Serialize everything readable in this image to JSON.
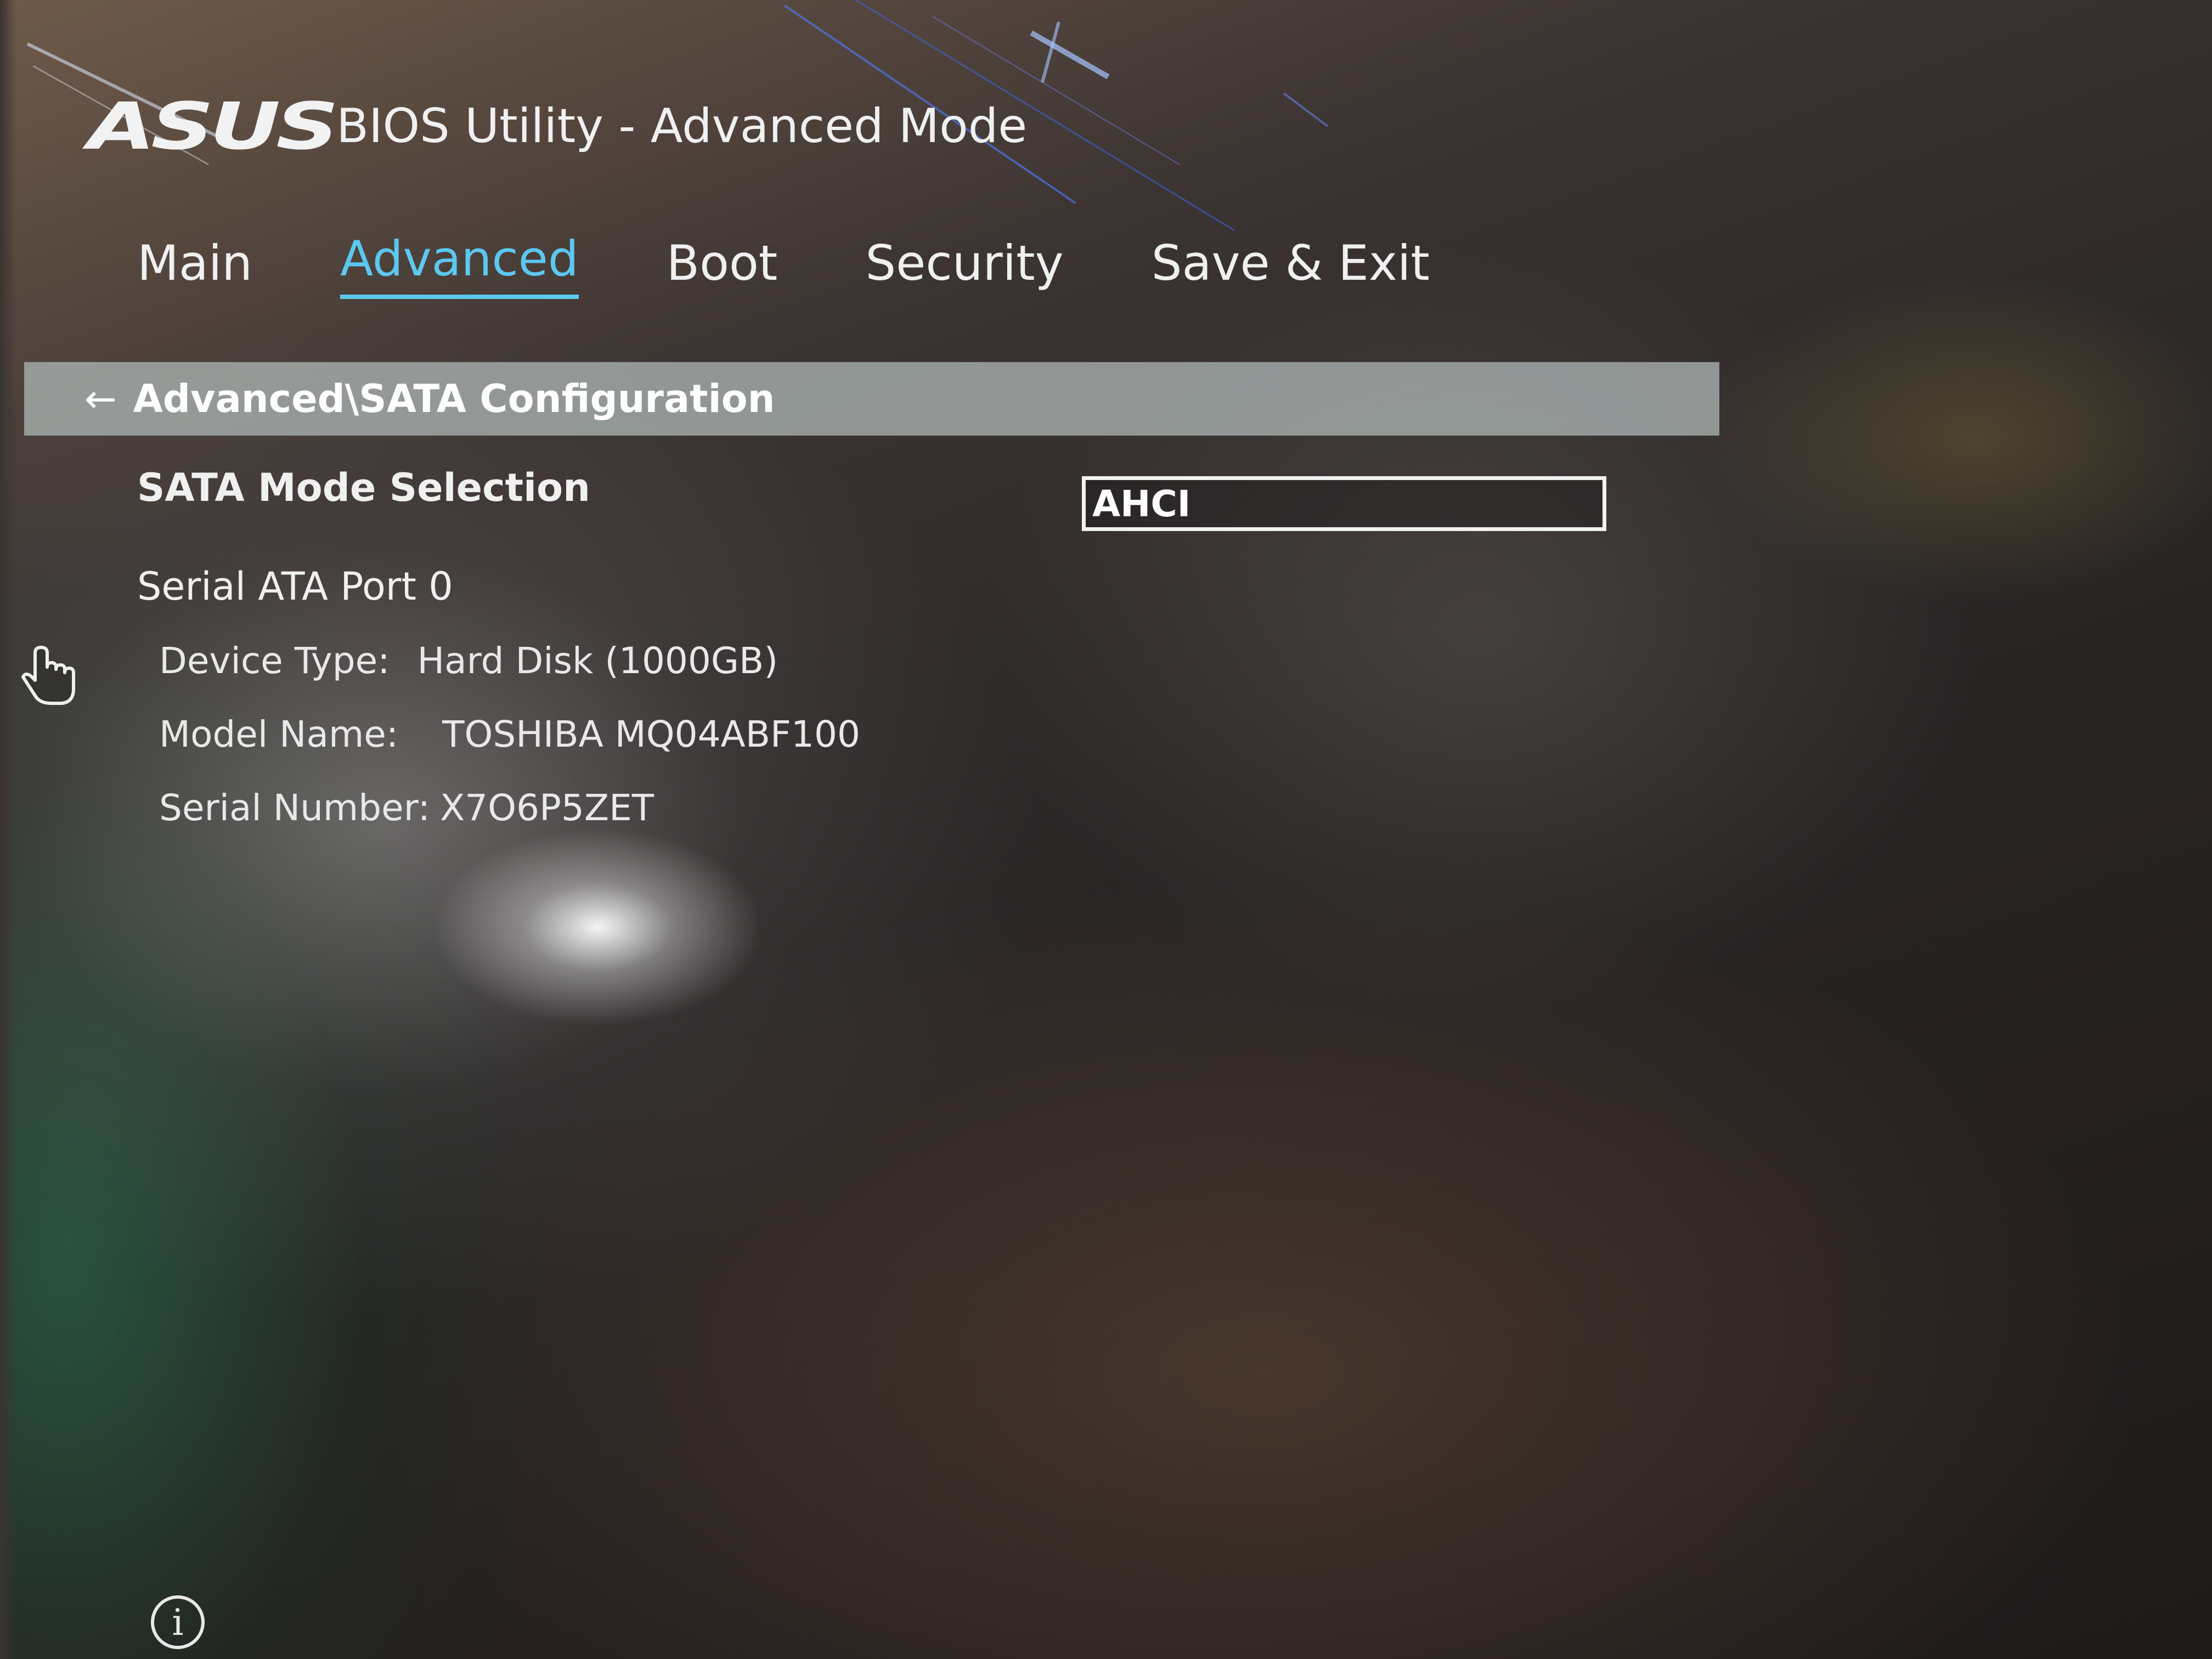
{
  "header": {
    "logo": "ASUS",
    "title": "BIOS Utility - Advanced Mode"
  },
  "tabs": [
    {
      "label": "Main",
      "active": false
    },
    {
      "label": "Advanced",
      "active": true
    },
    {
      "label": "Boot",
      "active": false
    },
    {
      "label": "Security",
      "active": false
    },
    {
      "label": "Save & Exit",
      "active": false
    }
  ],
  "breadcrumb": {
    "back_icon": "arrow-left-icon",
    "path": "Advanced\\SATA Configuration"
  },
  "settings": {
    "sata_mode": {
      "label": "SATA Mode Selection",
      "value": "AHCI"
    },
    "port0": {
      "label": "Serial ATA Port 0",
      "device_type_label": "Device Type:",
      "device_type_value": "Hard Disk  (1000GB)",
      "model_name_label": "Model Name:",
      "model_name_value": "TOSHIBA MQ04ABF100",
      "serial_number_label": "Serial Number:",
      "serial_number_value": "X7O6P5ZET"
    }
  },
  "icons": {
    "cursor": "hand-pointer-icon",
    "info": "info-icon",
    "info_glyph": "i"
  },
  "colors": {
    "active_tab": "#5cc8f0",
    "breadcrumb_bar": "#aab4b2",
    "text": "#f0f0f0"
  }
}
